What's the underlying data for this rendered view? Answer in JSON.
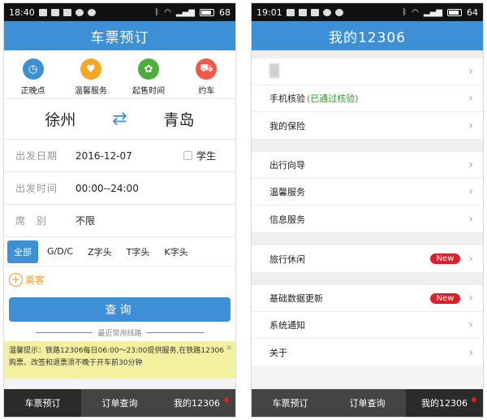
{
  "left": {
    "status": {
      "time": "18:40",
      "battery": "68"
    },
    "title": "车票预订",
    "quick": [
      {
        "label": "正晚点",
        "icon": "clock-icon",
        "color": "#3d8fd6",
        "glyph": "◷"
      },
      {
        "label": "温馨服务",
        "icon": "hands-icon",
        "color": "#f5a623",
        "glyph": "♥"
      },
      {
        "label": "起售时间",
        "icon": "leaf-icon",
        "color": "#4caf3a",
        "glyph": "✿"
      },
      {
        "label": "约车",
        "icon": "car-icon",
        "color": "#f05a4a",
        "glyph": "⛟"
      }
    ],
    "from": "徐州",
    "to": "青岛",
    "swap_glyph": "⇄",
    "date_label": "出发日期",
    "date_value": "2016-12-07",
    "student_label": "学生",
    "time_label": "出发时间",
    "time_value": "00:00--24:00",
    "seat_label": "席　别",
    "seat_value": "不限",
    "filters": [
      "全部",
      "G/D/C",
      "Z字头",
      "T字头",
      "K字头"
    ],
    "passenger_label": "乘客",
    "query_label": "查询",
    "recent_label": "最近常用线路",
    "notice_line1": "温馨提示：铁路12306每日06:00～23:00提供服务,在铁路12306",
    "notice_line2": "购票、改签和退票须不晚于开车前30分钟",
    "nav": [
      "车票预订",
      "订单查询",
      "我的12306"
    ]
  },
  "right": {
    "status": {
      "time": "19:01",
      "battery": "64"
    },
    "title": "我的12306",
    "phone_label": "手机核验",
    "phone_status": "(已通过核验)",
    "insurance_label": "我的保险",
    "guide_label": "出行向导",
    "warm_label": "温馨服务",
    "info_label": "信息服务",
    "travel_label": "旅行休闲",
    "new_badge": "New",
    "update_label": "基础数据更新",
    "notify_label": "系统通知",
    "about_label": "关于",
    "nav": [
      "车票预订",
      "订单查询",
      "我的12306"
    ]
  }
}
